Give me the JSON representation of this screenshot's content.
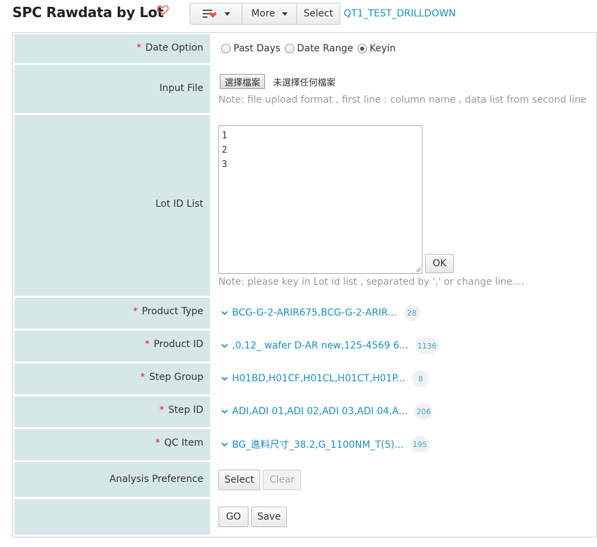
{
  "header": {
    "title": "SPC Rawdata by Lot",
    "favorite_icon": "heart-outline-icon",
    "menu_icon": "list-heart-icon",
    "more_label": "More",
    "select_label": "Select",
    "app_link": "QT1_TEST_DRILLDOWN"
  },
  "colors": {
    "label_bg": "#d6e7e7",
    "accent": "#1a8ec2",
    "required": "#e02020",
    "favorite": "#e8584a"
  },
  "form": {
    "date_option": {
      "label": "Date Option",
      "required": "*",
      "options": [
        "Past Days",
        "Date Range",
        "Keyin"
      ],
      "selected": "Keyin"
    },
    "input_file": {
      "label": "Input File",
      "button_label": "選擇檔案",
      "status": "未選擇任何檔案",
      "note": "Note: file upload format , first line : column name , data list from second line"
    },
    "lot_id_list": {
      "label": "Lot ID List",
      "lines": [
        "1",
        "2",
        "3"
      ],
      "ok_label": "OK",
      "note": "Note: please key in Lot id list , separated by ',' or change line...."
    },
    "product_type": {
      "label": "Product Type",
      "required": "*",
      "value": "BCG-G-2-ARIR675,BCG-G-2-ARIR...",
      "count": "28"
    },
    "product_id": {
      "label": "Product ID",
      "required": "*",
      "value": ",0,12_ wafer D-AR new,125-4569 6...",
      "count": "1136"
    },
    "step_group": {
      "label": "Step Group",
      "required": "*",
      "value": "H01BD,H01CF,H01CL,H01CT,H01P...",
      "count": "8"
    },
    "step_id": {
      "label": "Step ID",
      "required": "*",
      "value": "ADI,ADI 01,ADI 02,ADI 03,ADI 04,A...",
      "count": "206"
    },
    "qc_item": {
      "label": "QC Item",
      "required": "*",
      "value": "BG_進料尺寸_38.2,G_1100NM_T(5)...",
      "count": "195"
    },
    "analysis_preference": {
      "label": "Analysis Preference",
      "select_label": "Select",
      "clear_label": "Clear"
    },
    "actions": {
      "go_label": "GO",
      "save_label": "Save"
    }
  }
}
